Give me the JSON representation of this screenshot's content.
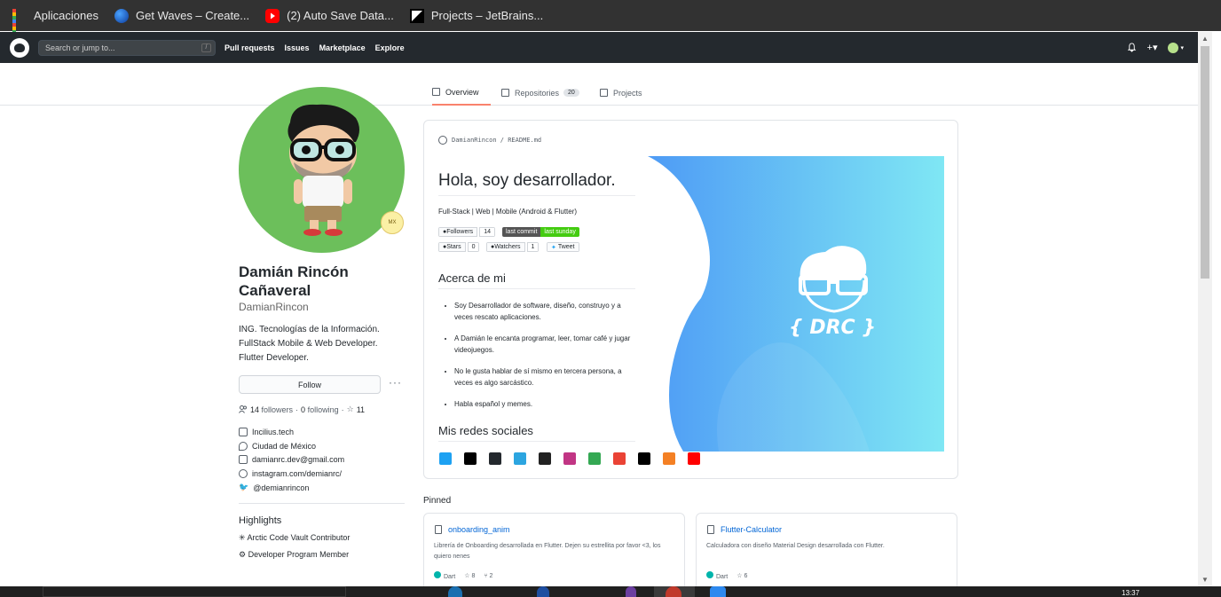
{
  "bookmarks": [
    {
      "label": "Aplicaciones",
      "icon": "apps-grid-icon"
    },
    {
      "label": "Get Waves – Create...",
      "icon": "waves-icon"
    },
    {
      "label": "(2) Auto Save Data...",
      "icon": "youtube-icon"
    },
    {
      "label": "Projects – JetBrains...",
      "icon": "jetbrains-icon"
    }
  ],
  "header": {
    "search_placeholder": "Search or jump to...",
    "search_shortcut": "/",
    "nav": [
      "Pull requests",
      "Issues",
      "Marketplace",
      "Explore"
    ],
    "right_plus": "+▾"
  },
  "tabs": [
    {
      "label": "Overview",
      "active": true
    },
    {
      "label": "Repositories",
      "count": "20"
    },
    {
      "label": "Projects"
    }
  ],
  "profile": {
    "badge": "MX",
    "full_name": "Damián Rincón Cañaveral",
    "username": "DamianRincon",
    "bio_lines": [
      "ING. Tecnologías de la Información.",
      "FullStack Mobile & Web Developer.",
      "Flutter Developer."
    ],
    "follow_label": "Follow",
    "more_label": "···",
    "followers_count": "14",
    "followers_label": "followers",
    "following_count": "0",
    "following_label": "following",
    "stars_count": "11",
    "details": [
      {
        "icon": "company-icon",
        "text": "Incilius.tech"
      },
      {
        "icon": "location-icon",
        "text": "Ciudad de México"
      },
      {
        "icon": "mail-icon",
        "text": "damianrc.dev@gmail.com"
      },
      {
        "icon": "link-icon",
        "text": "instagram.com/demianrc/"
      },
      {
        "icon": "twitter-icon",
        "text": "@demianrincon"
      }
    ],
    "highlights_title": "Highlights",
    "highlights": [
      "Arctic Code Vault Contributor",
      "Developer Program Member"
    ]
  },
  "readme": {
    "path": "DamianRincon / README.md",
    "title": "Hola, soy desarrollador.",
    "subtitle": "Full-Stack | Web | Mobile (Android & Flutter)",
    "badges": {
      "followers_label": "Followers",
      "followers_value": "14",
      "commit_label": "last commit",
      "commit_value": "last sunday",
      "stars_label": "Stars",
      "stars_value": "0",
      "watchers_label": "Watchers",
      "watchers_value": "1",
      "tweet_label": "Tweet"
    },
    "about_title": "Acerca de mi",
    "about_items": [
      "Soy Desarrollador de software, diseño, construyo y a veces rescato aplicaciones.",
      "A Damián le encanta programar, leer, tomar café y jugar videojuegos.",
      "No le gusta hablar de sí mismo en tercera persona, a veces es algo sarcástico.",
      "Habla español y memes."
    ],
    "socials_title": "Mis redes sociales",
    "socials": [
      {
        "name": "twitter-icon",
        "color": "#1da1f2"
      },
      {
        "name": "linkedin-icon",
        "color": "#000000"
      },
      {
        "name": "github-icon",
        "color": "#24292e"
      },
      {
        "name": "telegram-icon",
        "color": "#2ca5e0"
      },
      {
        "name": "codepen-icon",
        "color": "#222222"
      },
      {
        "name": "instagram-icon",
        "color": "#c13584"
      },
      {
        "name": "google-play-icon",
        "color": "#34a853"
      },
      {
        "name": "gmail-icon",
        "color": "#ea4335"
      },
      {
        "name": "facebook-icon",
        "color": "#000000"
      },
      {
        "name": "stackoverflow-icon",
        "color": "#f48024"
      },
      {
        "name": "youtube-icon",
        "color": "#ff0000"
      }
    ],
    "banner_text": "{ DRC }"
  },
  "pinned": {
    "title": "Pinned",
    "items": [
      {
        "name": "onboarding_anim",
        "desc": "Librería de Onboarding desarrollada en Flutter. Dejen su estrellita por favor <3, los quiero nenes",
        "lang": "Dart",
        "stars": "8",
        "forks": "2"
      },
      {
        "name": "Flutter-Calculator",
        "desc": "Calculadora con diseño Material Design desarrollada con Flutter.",
        "lang": "Dart",
        "stars": "6"
      }
    ]
  },
  "taskbar": {
    "clock": "13:37"
  },
  "colors": {
    "header_bg": "#24292e",
    "accent_tab": "#f9826c",
    "link": "#0366d6",
    "avatar_bg": "#6cbf5b"
  }
}
